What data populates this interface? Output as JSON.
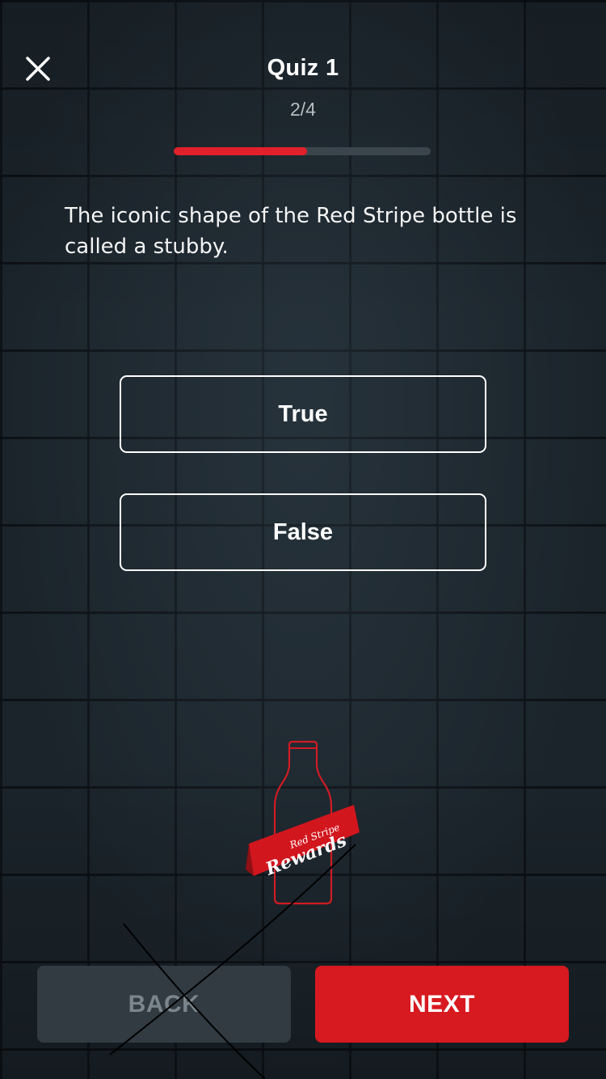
{
  "header": {
    "title": "Quiz 1",
    "progress_text": "2/4",
    "progress_fraction": 0.52
  },
  "question": {
    "text": "The iconic shape of the Red Stripe bottle is called a stubby."
  },
  "options": [
    {
      "label": "True"
    },
    {
      "label": "False"
    }
  ],
  "logo": {
    "line1": "Red Stripe",
    "line2": "Rewards"
  },
  "footer": {
    "back_label": "BACK",
    "next_label": "NEXT"
  },
  "icons": {
    "close": "close-icon"
  },
  "colors": {
    "accent": "#d71920",
    "progress_fill": "#e0202a",
    "progress_track": "#3b454d",
    "back_button": "#323b42",
    "back_text": "#7b858c",
    "background": "#1b242b"
  }
}
